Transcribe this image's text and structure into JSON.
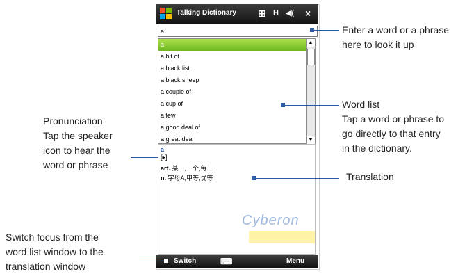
{
  "app": {
    "title": "Talking Dictionary"
  },
  "status": {
    "keyboard_glyph": "⊞",
    "signal_glyph": "H",
    "volume_glyph": "◀(",
    "close_glyph": "×"
  },
  "search": {
    "value": "a"
  },
  "word_list": {
    "items": [
      "a",
      "a bit of",
      "a black list",
      "a black sheep",
      "a couple of",
      "a cup of",
      "a few",
      "a good deal of",
      "a great deal"
    ]
  },
  "translation": {
    "headword": "a",
    "speaker_glyph": "[▸]",
    "definitions": [
      {
        "pos": "art.",
        "text": "某一,一个,每一"
      },
      {
        "pos": "n.",
        "text": "字母A,甲等,优等"
      }
    ],
    "logo": "Cyberon"
  },
  "menubar": {
    "left": "Switch",
    "right": "Menu"
  },
  "callouts": {
    "search": [
      "Enter a word or a phrase",
      "here to look it up"
    ],
    "word_list": [
      "Word list",
      "Tap a word or phrase to",
      "go directly to that entry",
      "in the dictionary."
    ],
    "pronunciation": [
      "Pronunciation",
      "Tap the speaker",
      "icon to hear the",
      "word or phrase"
    ],
    "translation": [
      "Translation"
    ],
    "switch": [
      "Switch focus from the",
      "word list window to the",
      "translation window"
    ]
  },
  "colors": {
    "accent": "#2d5aa8",
    "selection": "#7dc42a",
    "bar": "#1a1a1a"
  }
}
